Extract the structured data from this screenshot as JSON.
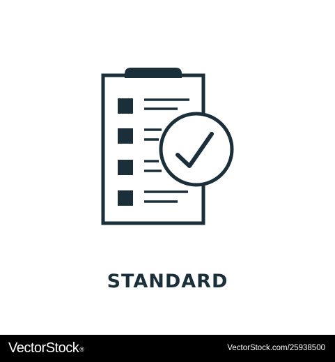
{
  "caption": "STANDARD",
  "icon": {
    "name": "clipboard-checklist-check-icon",
    "color": "#1b2f3a"
  },
  "footer": {
    "brand_text": "VectorStock",
    "brand_mark": "®",
    "image_id": "VectorStock.com/25938500",
    "background": "#000000"
  }
}
